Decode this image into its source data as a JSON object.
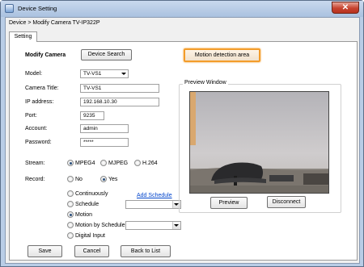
{
  "window": {
    "title": "Device Setting",
    "close_glyph": "✕"
  },
  "breadcrumb": "Device > Modify Camera TV-IP322P",
  "tab": {
    "label": "Setting"
  },
  "form": {
    "heading": "Modify Camera",
    "device_search_label": "Device Search",
    "motion_area_label": "Motion detection area",
    "model_label": "Model:",
    "model_value": "TV-VS1",
    "camera_title_label": "Camera Title:",
    "camera_title_value": "TV-VS1",
    "ip_label": "IP address:",
    "ip_value": "192.168.10.30",
    "port_label": "Port:",
    "port_value": "9235",
    "account_label": "Account:",
    "account_value": "admin",
    "password_label": "Password:",
    "password_value": "*****"
  },
  "stream": {
    "label": "Stream:",
    "options": [
      "MPEG4",
      "MJPEG",
      "H.264"
    ],
    "selected": "MPEG4"
  },
  "record": {
    "label": "Record:",
    "no": "No",
    "yes": "Yes",
    "selected": "Yes",
    "modes": [
      "Continuously",
      "Schedule",
      "Motion",
      "Motion by Schedule",
      "Digital Input"
    ],
    "selected_mode": "Motion",
    "add_schedule_link": "Add Schedule"
  },
  "preview": {
    "group_title": "Preview Window",
    "preview_button": "Preview",
    "disconnect_button": "Disconnect"
  },
  "footer": {
    "save": "Save",
    "cancel": "Cancel",
    "back": "Back to List"
  },
  "colors": {
    "highlight_border": "#f39c2a",
    "link": "#0044cc",
    "window_frame": "#b9cde6"
  }
}
